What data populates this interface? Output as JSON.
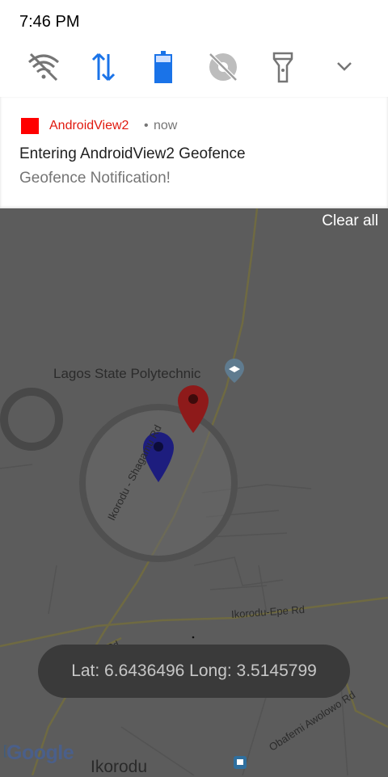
{
  "status_bar": {
    "time": "7:46 PM"
  },
  "quick_settings": [
    {
      "name": "wifi-off-icon",
      "color": "#757575"
    },
    {
      "name": "mobile-data-icon",
      "color": "#1a73e8"
    },
    {
      "name": "battery-saver-icon",
      "color": "#1a73e8"
    },
    {
      "name": "location-off-icon",
      "color": "#757575"
    },
    {
      "name": "flashlight-icon",
      "color": "#757575"
    },
    {
      "name": "chevron-down-icon",
      "color": "#757575"
    }
  ],
  "notification": {
    "app_name": "AndroidView2",
    "separator": "•",
    "time": "now",
    "title": "Entering AndroidView2 Geofence",
    "text": "Geofence Notification!",
    "app_color": "#ff0000"
  },
  "clear_all_label": "Clear all",
  "map": {
    "labels": {
      "poi": "Lagos State Polytechnic",
      "road_shagamu": "Ikorodu - Shagamu Rd",
      "road_epe": "Ikorodu-Epe Rd",
      "road_awolowo": "Obafemi Awolowo Rd",
      "road_small": "Rd",
      "town": "Ikorodu"
    },
    "markers": [
      {
        "name": "red-marker",
        "color": "#8e1a1a"
      },
      {
        "name": "blue-marker",
        "color": "#1d1d7e"
      }
    ]
  },
  "toast": "Lat: 6.6436496 Long: 3.5145799",
  "google_logo": "Google"
}
